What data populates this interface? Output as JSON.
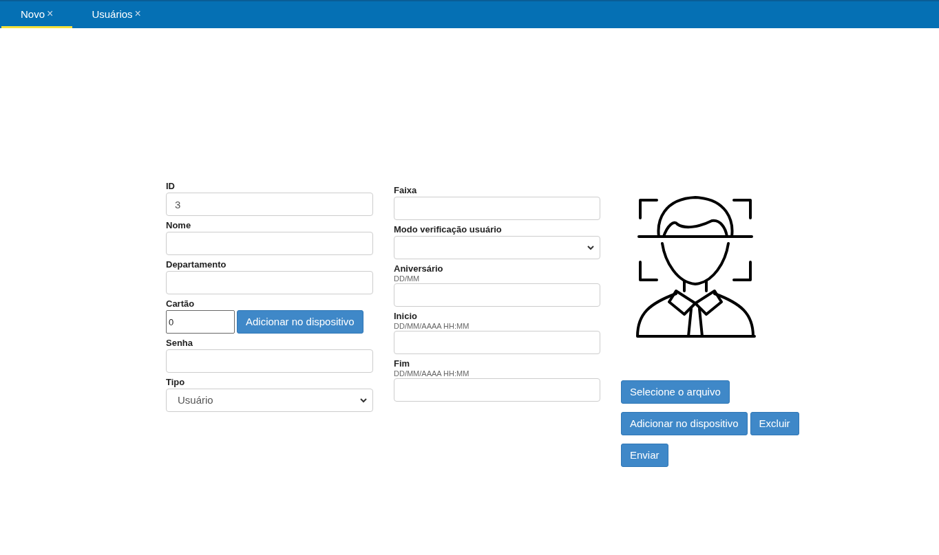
{
  "tabs": [
    {
      "label": "Novo",
      "close": "×",
      "selected": true
    },
    {
      "label": "Usuários",
      "close": "×",
      "selected": false
    }
  ],
  "left_fields": [
    {
      "kind": "input",
      "label": "ID",
      "value": "3"
    },
    {
      "kind": "input",
      "label": "Nome"
    },
    {
      "kind": "input",
      "label": "Departamento"
    },
    {
      "kind": "input_button",
      "label": "Cartão",
      "value": "0",
      "button": "Adicionar no dispositivo"
    },
    {
      "kind": "input",
      "label": "Senha"
    },
    {
      "kind": "select",
      "label": "Tipo",
      "value": "Usuário"
    }
  ],
  "right_fields": [
    {
      "kind": "input",
      "label": "Faixa"
    },
    {
      "kind": "select",
      "label": "Modo verificação usuário"
    },
    {
      "kind": "input",
      "label": "Aniversário",
      "hint": "DD/MM"
    },
    {
      "kind": "input",
      "label": "Inicio",
      "hint": "DD/MM/AAAA HH:MM"
    },
    {
      "kind": "input",
      "label": "Fim",
      "hint": "DD/MM/AAAA HH:MM"
    }
  ],
  "photo_buttons": [
    [
      "Selecione o arquivo"
    ],
    [
      "Adicionar no dispositivo",
      "Excluir"
    ],
    [
      "Enviar"
    ]
  ]
}
